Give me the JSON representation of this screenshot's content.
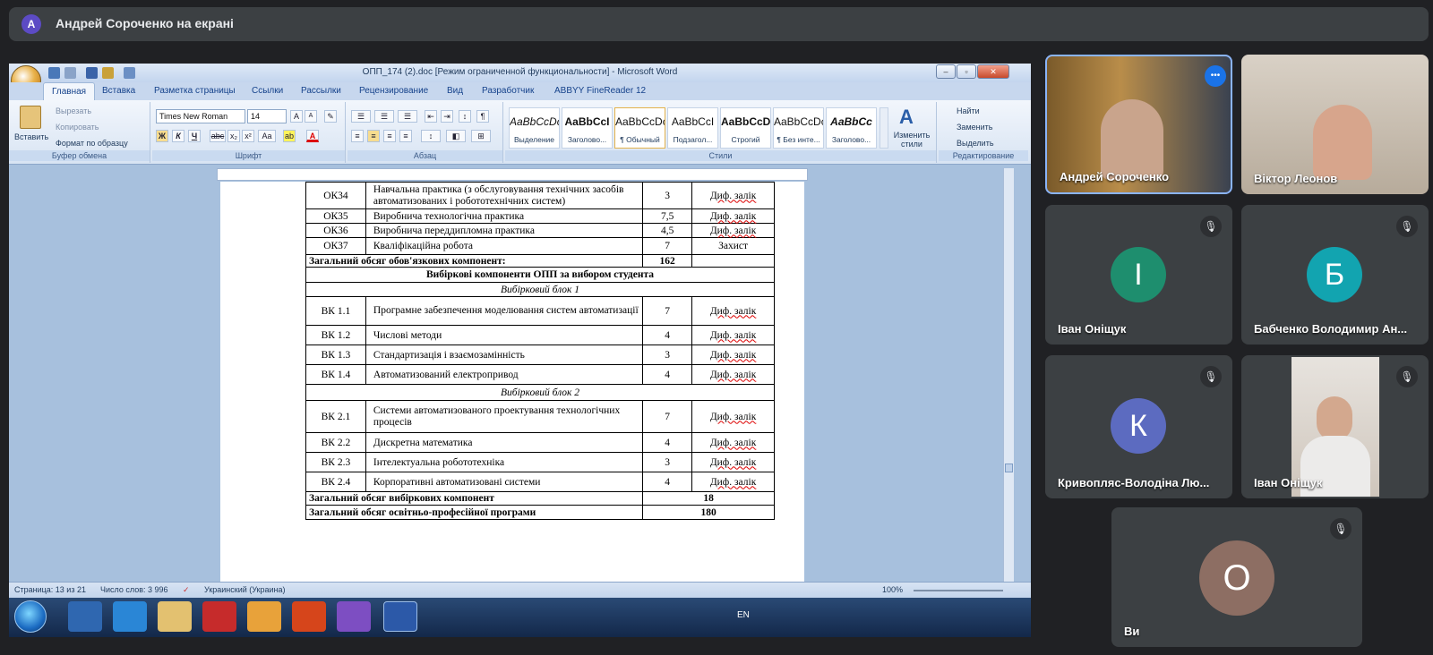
{
  "presenter_banner": {
    "avatar_letter": "А",
    "text": "Андрей Сороченко на екрані"
  },
  "word": {
    "title": "ОПП_174 (2).doc [Режим ограниченной функциональности] - Microsoft Word",
    "tabs": [
      "Главная",
      "Вставка",
      "Разметка страницы",
      "Ссылки",
      "Рассылки",
      "Рецензирование",
      "Вид",
      "Разработчик",
      "ABBYY FineReader 12"
    ],
    "clipboard": {
      "paste": "Вставить",
      "cut": "Вырезать",
      "copy": "Копировать",
      "format": "Формат по образцу",
      "label": "Буфер обмена"
    },
    "font": {
      "name": "Times New Roman",
      "size": "14",
      "label": "Шрифт",
      "bold": "Ж",
      "italic": "К",
      "underline": "Ч",
      "grow": "A",
      "shrink": "A",
      "clear": "Аа"
    },
    "paragraph": {
      "label": "Абзац"
    },
    "styles": {
      "label": "Стили",
      "items": [
        {
          "sample": "AaBbCcDc",
          "name": "Выделение"
        },
        {
          "sample": "AaBbCcI",
          "name": "Заголово..."
        },
        {
          "sample": "AaBbCcDc",
          "name": "¶ Обычный"
        },
        {
          "sample": "AaBbCcI",
          "name": "Подзагол..."
        },
        {
          "sample": "AaBbCcDd",
          "name": "Строгий"
        },
        {
          "sample": "AaBbCcDc",
          "name": "¶ Без инте..."
        },
        {
          "sample": "AaBbCc",
          "name": "Заголово..."
        }
      ],
      "change": "Изменить стили"
    },
    "editing": {
      "find": "Найти",
      "replace": "Заменить",
      "select": "Выделить",
      "label": "Редактирование"
    },
    "status": {
      "page": "Страница: 13 из 21",
      "words": "Число слов: 3 996",
      "lang": "Украинский (Украина)",
      "zoom": "100%"
    },
    "tray": {
      "lang": "EN"
    }
  },
  "table": {
    "rows_top": [
      {
        "code": "ОК34",
        "name": "Навчальна практика (з обслуговування технічних засобів автоматизованих і робототехнічних систем)",
        "credits": "3",
        "form": "Диф. залік"
      },
      {
        "code": "ОК35",
        "name": "Виробнича технологічна практика",
        "credits": "7,5",
        "form": "Диф. залік"
      },
      {
        "code": "ОК36",
        "name": "Виробнича переддипломна практика",
        "credits": "4,5",
        "form": "Диф. залік"
      },
      {
        "code": "ОК37",
        "name": "Кваліфікаційна робота",
        "credits": "7",
        "form": "Захист"
      }
    ],
    "mandatory_total": {
      "label": "Загальний обсяг обов'язкових компонент:",
      "value": "162"
    },
    "elective_header": "Вибіркові компоненти ОПП за вибором студента",
    "block1": "Вибірковий блок 1",
    "block1_rows": [
      {
        "code": "ВК 1.1",
        "name": "Програмне забезпечення моделювання систем автоматизації",
        "credits": "7",
        "form": "Диф. залік"
      },
      {
        "code": "ВК 1.2",
        "name": "Числові методи",
        "credits": "4",
        "form": "Диф. залік"
      },
      {
        "code": "ВК 1.3",
        "name": "Стандартизація і взаємозамінність",
        "credits": "3",
        "form": "Диф. залік"
      },
      {
        "code": "ВК 1.4",
        "name": "Автоматизований електропривод",
        "credits": "4",
        "form": "Диф. залік"
      }
    ],
    "block2": "Вибірковий блок 2",
    "block2_rows": [
      {
        "code": "ВК 2.1",
        "name": "Системи автоматизованого проектування технологічних процесів",
        "credits": "7",
        "form": "Диф. залік"
      },
      {
        "code": "ВК 2.2",
        "name": "Дискретна математика",
        "credits": "4",
        "form": "Диф. залік"
      },
      {
        "code": "ВК 2.3",
        "name": "Інтелектуальна робототехніка",
        "credits": "3",
        "form": "Диф. залік"
      },
      {
        "code": "ВК 2.4",
        "name": "Корпоративні автоматизовані системи",
        "credits": "4",
        "form": "Диф. залік"
      }
    ],
    "elective_total": {
      "label": "Загальний обсяг вибіркових компонент",
      "value": "18"
    },
    "program_total": {
      "label": "Загальний обсяг освітньо-професійної програми",
      "value": "180"
    }
  },
  "participants": [
    {
      "name": "Андрей Сороченко",
      "type": "video",
      "more": "•••"
    },
    {
      "name": "Віктор Леонов",
      "type": "video"
    },
    {
      "name": "Іван Оніщук",
      "letter": "І",
      "color": "#1e8e6e"
    },
    {
      "name": "Бабченко Володимир Ан...",
      "letter": "Б",
      "color": "#12a4b0"
    },
    {
      "name": "Кривопляс-Володіна Лю...",
      "letter": "К",
      "color": "#5c6bc0"
    },
    {
      "name": "Іван Оніщук",
      "type": "video"
    },
    {
      "name": "Ви",
      "letter": "О",
      "color": "#8d6e63"
    }
  ]
}
